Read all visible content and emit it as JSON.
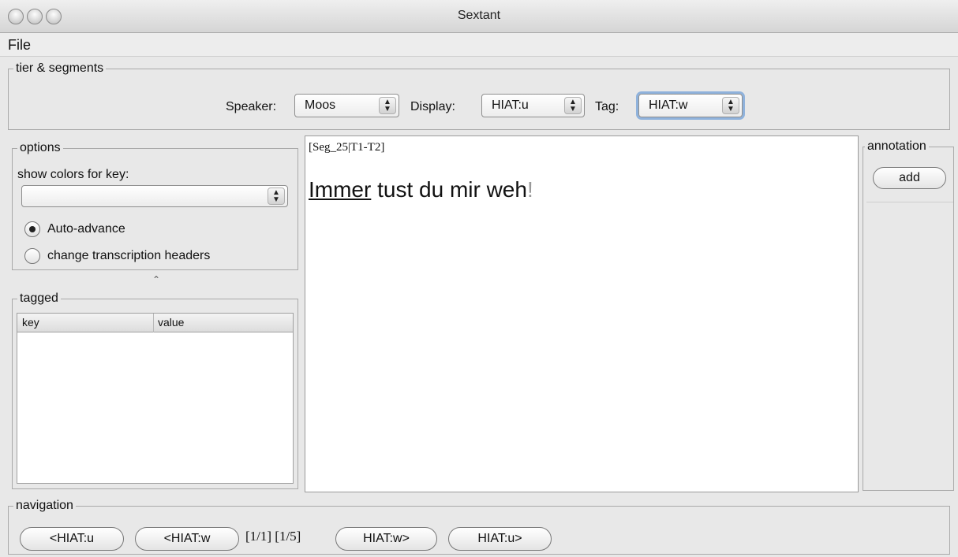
{
  "window": {
    "title": "Sextant"
  },
  "menu": {
    "file": "File"
  },
  "tier_segments": {
    "title": "tier & segments",
    "speaker_label": "Speaker:",
    "speaker_value": "Moos",
    "display_label": "Display:",
    "display_value": "HIAT:u",
    "tag_label": "Tag:",
    "tag_value": "HIAT:w"
  },
  "options": {
    "title": "options",
    "colors_label": "show colors for key:",
    "colors_value": "",
    "auto_advance": "Auto-advance",
    "auto_advance_checked": true,
    "change_headers": "change transcription headers",
    "change_headers_checked": false
  },
  "tagged": {
    "title": "tagged",
    "columns": [
      "key",
      "value"
    ],
    "rows": []
  },
  "editor": {
    "segment_header": "[Seg_25|T1-T2]",
    "utterance_highlight": "Immer",
    "utterance_rest": " tust du mir weh",
    "utterance_punct": "!"
  },
  "annotation": {
    "title": "annotation",
    "add_label": "add"
  },
  "navigation": {
    "title": "navigation",
    "prev_u": "<HIAT:u",
    "prev_w": "<HIAT:w",
    "position": "[1/1] [1/5]",
    "next_w": "HIAT:w>",
    "next_u": "HIAT:u>"
  },
  "colors": {
    "focus_ring": "#8fb2dc",
    "background": "#e8e8e8"
  }
}
